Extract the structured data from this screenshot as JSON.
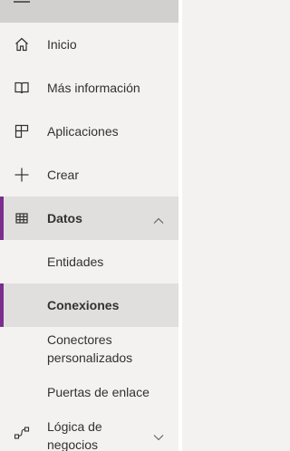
{
  "colors": {
    "background": "#f3f2f1",
    "active_background": "#e1dfdd",
    "header_background": "#d2d0ce",
    "accent": "#7b2e8e",
    "text": "#323130",
    "icon": "#605e5c"
  },
  "header": {
    "menu_icon": "hamburger-icon"
  },
  "nav": {
    "items": [
      {
        "label": "Inicio",
        "icon": "home-icon"
      },
      {
        "label": "Más información",
        "icon": "book-icon"
      },
      {
        "label": "Aplicaciones",
        "icon": "apps-icon"
      },
      {
        "label": "Crear",
        "icon": "plus-icon"
      },
      {
        "label": "Datos",
        "icon": "table-icon",
        "expanded": true,
        "selected_section": true
      },
      {
        "label": "Lógica de negocios",
        "icon": "flow-icon",
        "expanded": false
      }
    ],
    "datos_children": [
      {
        "label": "Entidades"
      },
      {
        "label": "Conexiones",
        "selected": true
      },
      {
        "label": "Conectores personalizados"
      },
      {
        "label": "Puertas de enlace"
      }
    ]
  }
}
